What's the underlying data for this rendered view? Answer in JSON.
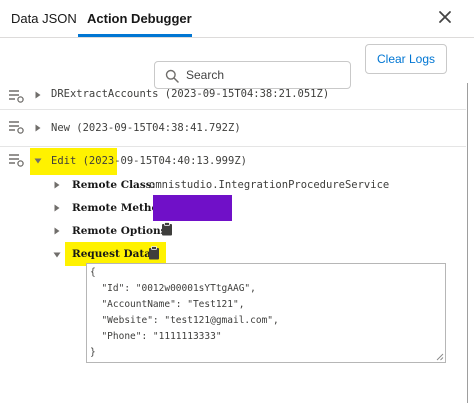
{
  "tabs": [
    {
      "label": "Data JSON"
    },
    {
      "label": "Action Debugger"
    }
  ],
  "toolbar": {
    "clear_label": "Clear Logs"
  },
  "search": {
    "placeholder": "Search"
  },
  "logs": [
    {
      "title": "DRExtractAccounts (2023-09-15T04:38:21.051Z)"
    },
    {
      "title": "New (2023-09-15T04:38:41.792Z)"
    },
    {
      "title": "Edit (2023-09-15T04:40:13.999Z)"
    }
  ],
  "details": {
    "remote_class_label": "Remote Class:",
    "remote_class_value": "omnistudio.IntegrationProcedureService",
    "remote_method_label": "Remote Method:",
    "remote_options_label": "Remote Options:",
    "request_data_label": "Request Data:",
    "request_json": [
      "{",
      "  \"Id\": \"0012w00001sYTtgAAG\",",
      "  \"AccountName\": \"Test121\",",
      "  \"Website\": \"test121@gmail.com\",",
      "  \"Phone\": \"1111113333\"",
      "}"
    ]
  },
  "colors": {
    "accent": "#0176d3",
    "highlight": "#fff200",
    "redaction": "#7010c8"
  }
}
